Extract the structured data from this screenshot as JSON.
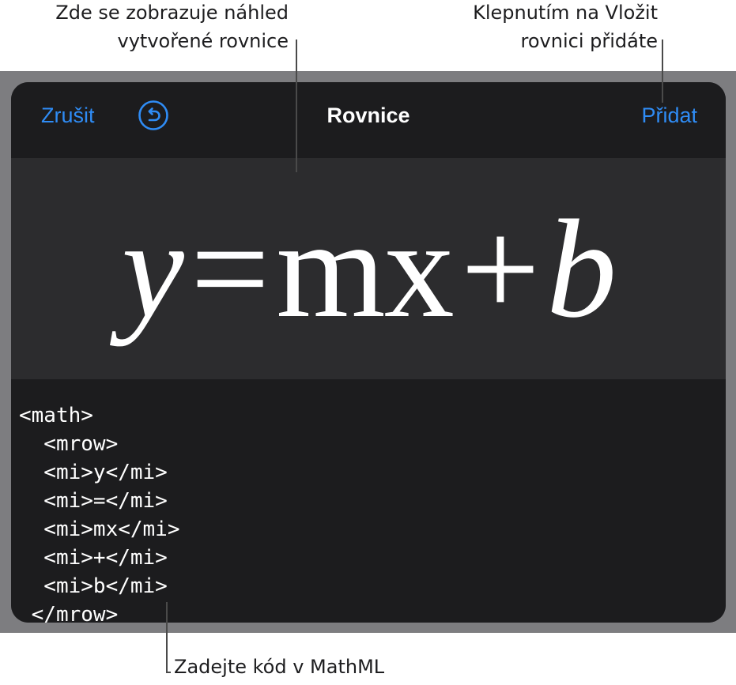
{
  "callouts": {
    "preview": "Zde se zobrazuje náhled\nvytvořené rovnice",
    "add": "Klepnutím na Vložit\nrovnici přidáte",
    "code": "Zadejte kód v MathML"
  },
  "nav": {
    "cancel_label": "Zrušit",
    "undo_icon": "undo-icon",
    "title": "Rovnice",
    "add_label": "Přidat"
  },
  "preview": {
    "y": "y",
    "eq": "=",
    "mx": "mx",
    "plus": "+",
    "b": "b"
  },
  "editor": {
    "code": "<math>\n  <mrow>\n  <mi>y</mi>\n  <mi>=</mi>\n  <mi>mx</mi>\n  <mi>+</mi>\n  <mi>b</mi>\n </mrow>"
  },
  "colors": {
    "accent": "#2f8cf5",
    "sheet_background": "#1c1c1e",
    "preview_background": "#2c2c2e",
    "frame": "#7d7d80"
  }
}
